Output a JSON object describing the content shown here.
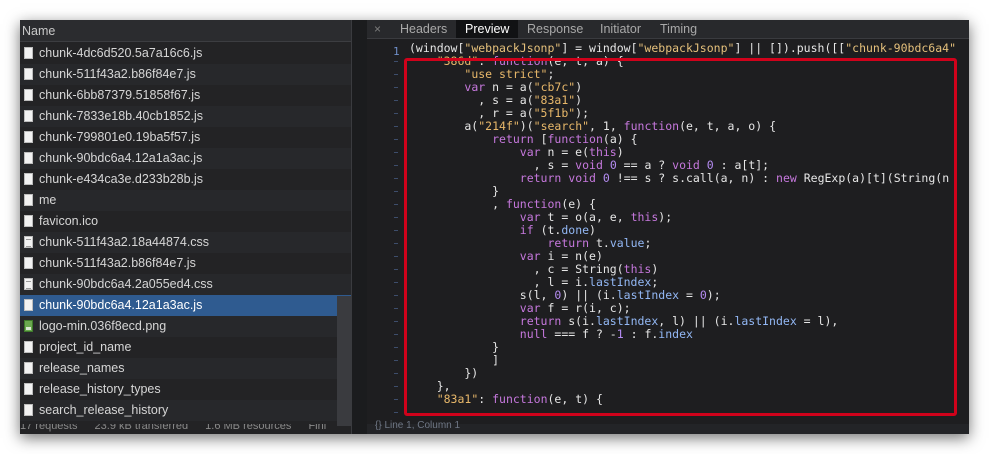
{
  "network": {
    "column_header": "Name",
    "files": [
      {
        "name": "chunk-4dc6d520.5a7a16c6.js",
        "icon": "js-file-icon"
      },
      {
        "name": "chunk-511f43a2.b86f84e7.js",
        "icon": "js-file-icon"
      },
      {
        "name": "chunk-6bb87379.51858f67.js",
        "icon": "js-file-icon"
      },
      {
        "name": "chunk-7833e18b.40cb1852.js",
        "icon": "js-file-icon"
      },
      {
        "name": "chunk-799801e0.19ba5f57.js",
        "icon": "js-file-icon"
      },
      {
        "name": "chunk-90bdc6a4.12a1a3ac.js",
        "icon": "js-file-icon"
      },
      {
        "name": "chunk-e434ca3e.d233b28b.js",
        "icon": "js-file-icon"
      },
      {
        "name": "me",
        "icon": "document-icon"
      },
      {
        "name": "favicon.ico",
        "icon": "document-icon"
      },
      {
        "name": "chunk-511f43a2.18a44874.css",
        "icon": "css-file-icon"
      },
      {
        "name": "chunk-511f43a2.b86f84e7.js",
        "icon": "js-file-icon"
      },
      {
        "name": "chunk-90bdc6a4.2a055ed4.css",
        "icon": "css-file-icon"
      },
      {
        "name": "chunk-90bdc6a4.12a1a3ac.js",
        "icon": "js-file-icon",
        "selected": true
      },
      {
        "name": "logo-min.036f8ecd.png",
        "icon": "image-file-icon"
      },
      {
        "name": "project_id_name",
        "icon": "document-icon"
      },
      {
        "name": "release_names",
        "icon": "document-icon"
      },
      {
        "name": "release_history_types",
        "icon": "document-icon"
      },
      {
        "name": "search_release_history",
        "icon": "document-icon"
      }
    ],
    "status": {
      "requests": "17 requests",
      "transferred": "23.9 kB transferred",
      "resources": "1.6 MB resources",
      "finish": "Fini"
    }
  },
  "tabs": {
    "close": "×",
    "items": [
      "Headers",
      "Preview",
      "Response",
      "Initiator",
      "Timing"
    ],
    "active": "Preview"
  },
  "code": {
    "first_line_number": "1",
    "bottom_status": "{}  Line 1, Column 1"
  },
  "colors": {
    "highlight_border": "#d0021b",
    "selected_row": "#2f5b90"
  }
}
